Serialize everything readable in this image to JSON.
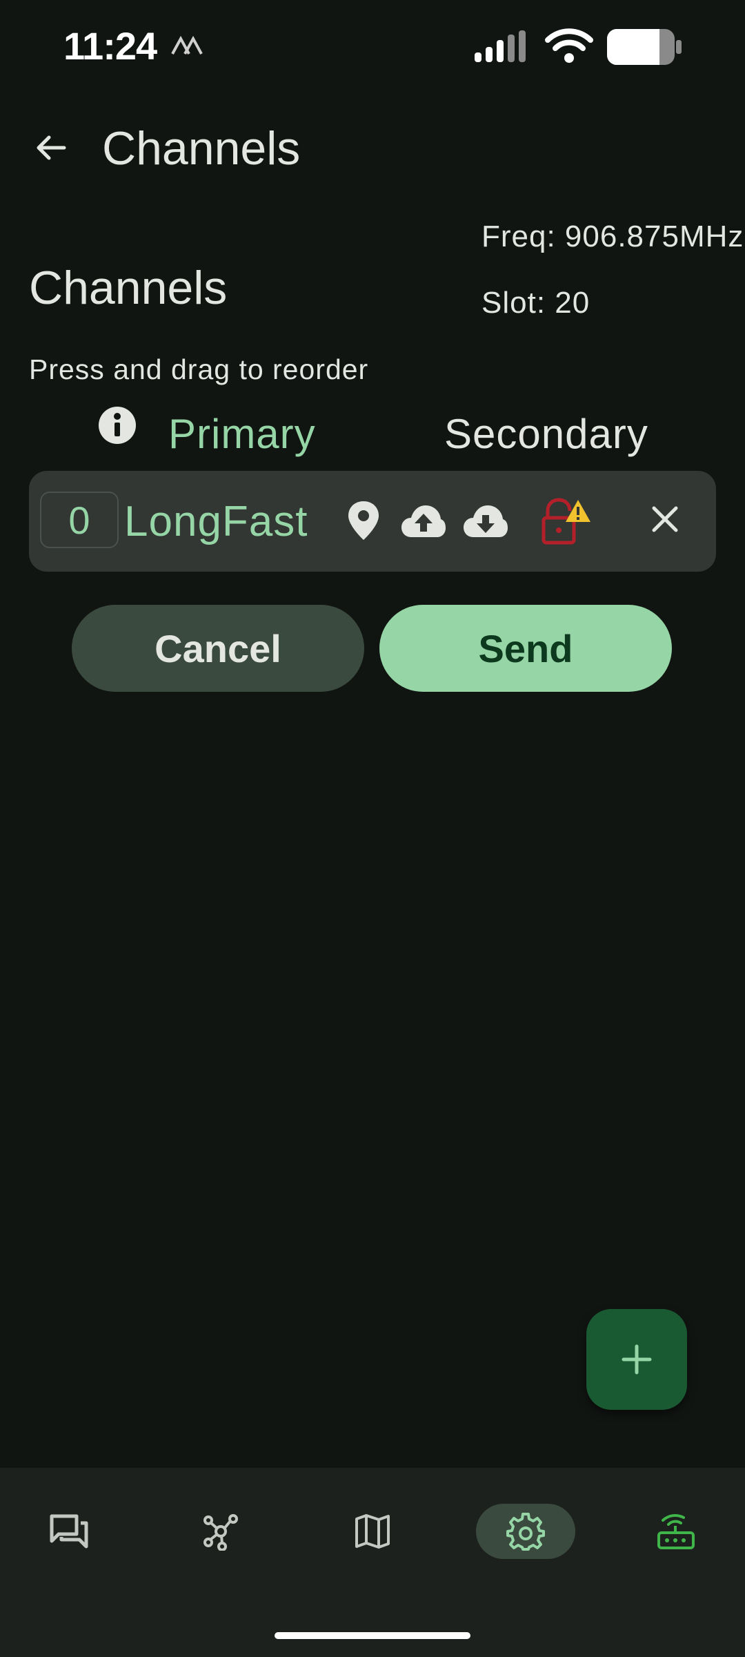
{
  "status_bar": {
    "time": "11:24",
    "icons": [
      "navigation-arrows-icon",
      "cellular-signal-icon",
      "wifi-icon",
      "battery-icon"
    ]
  },
  "app_bar": {
    "title": "Channels",
    "back_icon": "arrow-back-icon"
  },
  "radio_info": {
    "freq": "Freq: 906.875MHz",
    "slot": "Slot: 20"
  },
  "section": {
    "title": "Channels",
    "hint": "Press and drag to reorder"
  },
  "channel_header": {
    "info_icon": "info-icon",
    "primary_label": "Primary",
    "secondary_label": "Secondary"
  },
  "channels": [
    {
      "index": "0",
      "name": "LongFast",
      "icons": [
        "location-icon",
        "cloud-upload-icon",
        "cloud-download-icon",
        "lock-open-warning-icon",
        "close-icon"
      ]
    }
  ],
  "actions": {
    "cancel_label": "Cancel",
    "send_label": "Send"
  },
  "fab": {
    "icon": "add-icon"
  },
  "bottom_nav": {
    "items": [
      {
        "id": "messages",
        "icon": "chat-icon",
        "selected": false
      },
      {
        "id": "nodes",
        "icon": "nodes-icon",
        "selected": false
      },
      {
        "id": "map",
        "icon": "map-icon",
        "selected": false
      },
      {
        "id": "settings",
        "icon": "settings-icon",
        "selected": true
      },
      {
        "id": "connections",
        "icon": "router-icon",
        "selected": false
      }
    ]
  },
  "colors": {
    "background": "#111512",
    "accent": "#95d5a6",
    "row_background": "#323733",
    "warning": "#f2c12e",
    "danger": "#b3202a",
    "connection_green": "#3fb54a"
  }
}
